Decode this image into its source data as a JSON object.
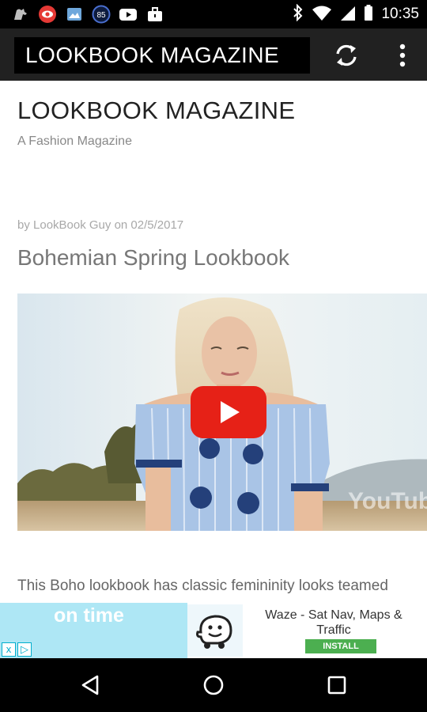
{
  "status_bar": {
    "time": "10:35",
    "left_icons": [
      "mouse-app-icon",
      "eye-app-icon",
      "image-app-icon",
      "speed-85-icon",
      "youtube-icon",
      "briefcase-icon"
    ],
    "speed_badge": "85",
    "right_icons": [
      "bluetooth-icon",
      "wifi-icon",
      "signal-icon",
      "battery-icon"
    ]
  },
  "app_bar": {
    "title": "LOOKBOOK MAGAZINE",
    "actions": [
      "refresh-icon",
      "overflow-menu-icon"
    ]
  },
  "site": {
    "title": "LOOKBOOK MAGAZINE",
    "tagline": "A Fashion Magazine"
  },
  "post": {
    "meta": "by LookBook Guy on 02/5/2017",
    "title": "Bohemian Spring Lookbook",
    "video_watermark": "YouTube",
    "excerpt": "This Boho lookbook has classic femininity looks teamed"
  },
  "ad": {
    "headline": "on time",
    "app_title": "Waze - Sat Nav, Maps & Traffic",
    "install_label": "INSTALL",
    "close_labels": [
      "x",
      "▷"
    ]
  },
  "nav_bar": {
    "buttons": [
      "back-icon",
      "home-icon",
      "recents-icon"
    ]
  },
  "colors": {
    "status_bar": "#000000",
    "app_bar": "#212121",
    "ad_left": "#aee7f5",
    "install": "#4caf50",
    "youtube_red": "#e62117"
  }
}
